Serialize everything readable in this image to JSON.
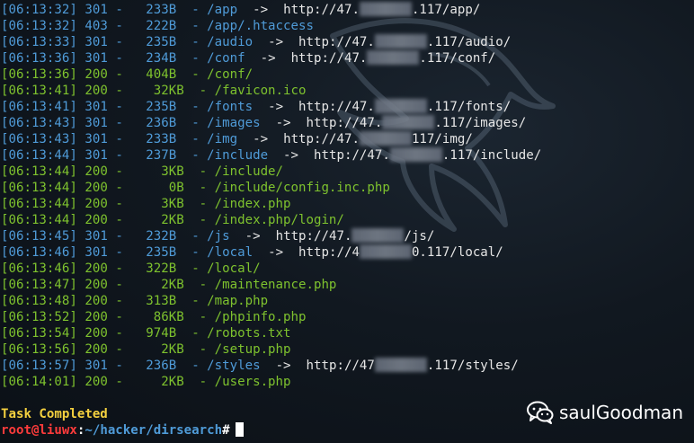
{
  "log": [
    {
      "ts": "[06:13:32]",
      "code": "301",
      "size": "  233B",
      "path": "/app",
      "arrow": "->",
      "redirect_pre": "http://47.",
      "redirect_post": ".117/app/"
    },
    {
      "ts": "[06:13:32]",
      "code": "403",
      "size": "  222B",
      "path": "/app/.htaccess",
      "arrow": "",
      "redirect_pre": "",
      "redirect_post": ""
    },
    {
      "ts": "[06:13:33]",
      "code": "301",
      "size": "  235B",
      "path": "/audio",
      "arrow": "->",
      "redirect_pre": "http://47.",
      "redirect_post": ".117/audio/"
    },
    {
      "ts": "[06:13:36]",
      "code": "301",
      "size": "  234B",
      "path": "/conf",
      "arrow": "->",
      "redirect_pre": "http://47.",
      "redirect_post": ".117/conf/"
    },
    {
      "ts": "[06:13:36]",
      "code": "200",
      "size": "  404B",
      "path": "/conf/",
      "arrow": "",
      "redirect_pre": "",
      "redirect_post": ""
    },
    {
      "ts": "[06:13:41]",
      "code": "200",
      "size": "   32KB",
      "path": "/favicon.ico",
      "arrow": "",
      "redirect_pre": "",
      "redirect_post": ""
    },
    {
      "ts": "[06:13:41]",
      "code": "301",
      "size": "  235B",
      "path": "/fonts",
      "arrow": "->",
      "redirect_pre": "http://47.",
      "redirect_post": ".117/fonts/"
    },
    {
      "ts": "[06:13:43]",
      "code": "301",
      "size": "  236B",
      "path": "/images",
      "arrow": "->",
      "redirect_pre": "http://47.",
      "redirect_post": ".117/images/"
    },
    {
      "ts": "[06:13:43]",
      "code": "301",
      "size": "  233B",
      "path": "/img",
      "arrow": "->",
      "redirect_pre": "http://47.",
      "redirect_post": "117/img/"
    },
    {
      "ts": "[06:13:44]",
      "code": "301",
      "size": "  237B",
      "path": "/include",
      "arrow": "->",
      "redirect_pre": "http://47.",
      "redirect_post": ".117/include/"
    },
    {
      "ts": "[06:13:44]",
      "code": "200",
      "size": "    3KB",
      "path": "/include/",
      "arrow": "",
      "redirect_pre": "",
      "redirect_post": ""
    },
    {
      "ts": "[06:13:44]",
      "code": "200",
      "size": "     0B",
      "path": "/include/config.inc.php",
      "arrow": "",
      "redirect_pre": "",
      "redirect_post": ""
    },
    {
      "ts": "[06:13:44]",
      "code": "200",
      "size": "    3KB",
      "path": "/index.php",
      "arrow": "",
      "redirect_pre": "",
      "redirect_post": ""
    },
    {
      "ts": "[06:13:44]",
      "code": "200",
      "size": "    2KB",
      "path": "/index.php/login/",
      "arrow": "",
      "redirect_pre": "",
      "redirect_post": ""
    },
    {
      "ts": "[06:13:45]",
      "code": "301",
      "size": "  232B",
      "path": "/js",
      "arrow": "->",
      "redirect_pre": "http://47.",
      "redirect_post": "/js/"
    },
    {
      "ts": "[06:13:46]",
      "code": "301",
      "size": "  235B",
      "path": "/local",
      "arrow": "->",
      "redirect_pre": "http://4",
      "redirect_post": "0.117/local/"
    },
    {
      "ts": "[06:13:46]",
      "code": "200",
      "size": "  322B",
      "path": "/local/",
      "arrow": "",
      "redirect_pre": "",
      "redirect_post": ""
    },
    {
      "ts": "[06:13:47]",
      "code": "200",
      "size": "    2KB",
      "path": "/maintenance.php",
      "arrow": "",
      "redirect_pre": "",
      "redirect_post": ""
    },
    {
      "ts": "[06:13:48]",
      "code": "200",
      "size": "  313B",
      "path": "/map.php",
      "arrow": "",
      "redirect_pre": "",
      "redirect_post": ""
    },
    {
      "ts": "[06:13:52]",
      "code": "200",
      "size": "   86KB",
      "path": "/phpinfo.php",
      "arrow": "",
      "redirect_pre": "",
      "redirect_post": ""
    },
    {
      "ts": "[06:13:54]",
      "code": "200",
      "size": "  974B",
      "path": "/robots.txt",
      "arrow": "",
      "redirect_pre": "",
      "redirect_post": ""
    },
    {
      "ts": "[06:13:56]",
      "code": "200",
      "size": "    2KB",
      "path": "/setup.php",
      "arrow": "",
      "redirect_pre": "",
      "redirect_post": ""
    },
    {
      "ts": "[06:13:57]",
      "code": "301",
      "size": "  236B",
      "path": "/styles",
      "arrow": "->",
      "redirect_pre": "http://47",
      "redirect_post": ".117/styles/"
    },
    {
      "ts": "[06:14:01]",
      "code": "200",
      "size": "    2KB",
      "path": "/users.php",
      "arrow": "",
      "redirect_pre": "",
      "redirect_post": ""
    }
  ],
  "status_text": "Task Completed",
  "prompt": {
    "user": "root@liuwx",
    "colon": ":",
    "path": "~/hacker/dirsearch",
    "hash": "#"
  },
  "watermark": {
    "text": "saulGoodman",
    "icon": "wechat-icon"
  },
  "colors": {
    "redirect_code": "#4f9bd8",
    "success_code": "#7ec22e",
    "status": "#f4d03f",
    "prompt_user": "#ff3b3b",
    "prompt_path": "#4f9bd8"
  }
}
